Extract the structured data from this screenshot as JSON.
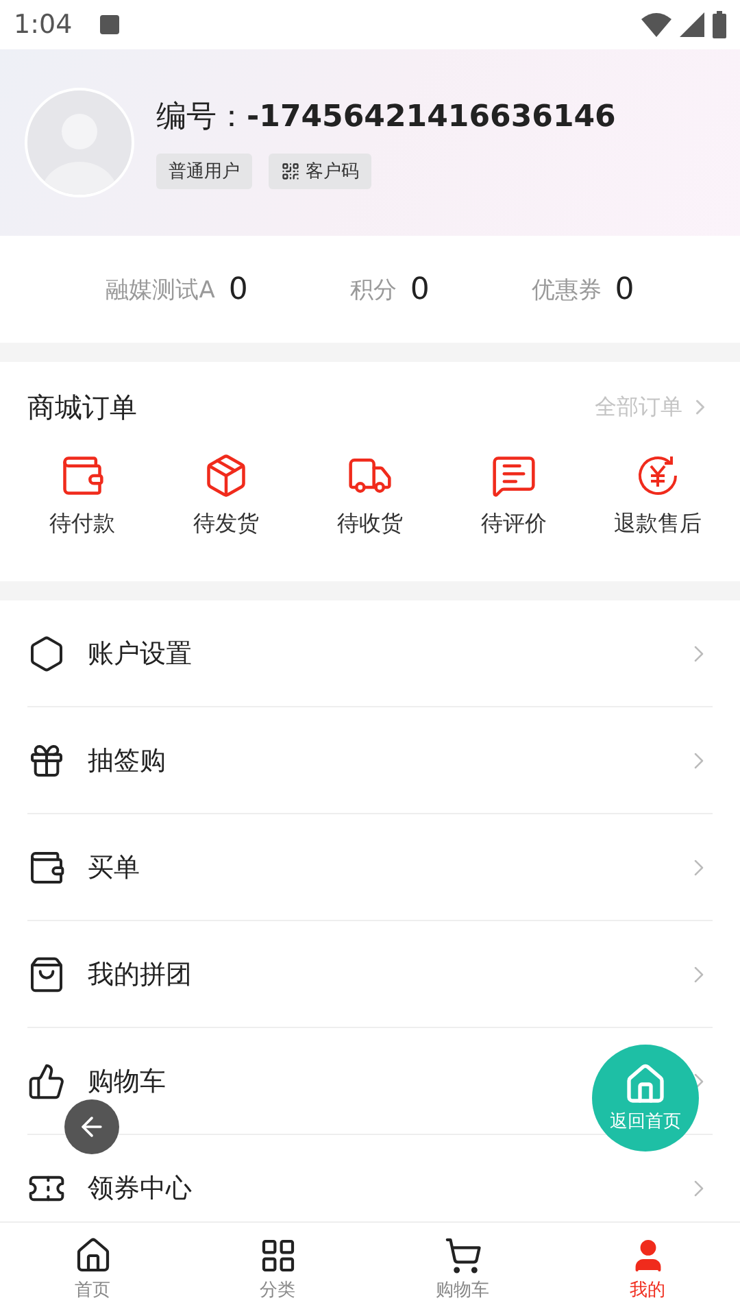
{
  "status_bar": {
    "time": "1:04"
  },
  "profile": {
    "id_label": "编号：",
    "id_value": "-17456421416636146",
    "tags": [
      {
        "label": "普通用户",
        "kind": "plain"
      },
      {
        "label": "客户码",
        "kind": "qr"
      }
    ]
  },
  "stats": [
    {
      "label": "融媒测试A",
      "value": "0"
    },
    {
      "label": "积分",
      "value": "0"
    },
    {
      "label": "优惠券",
      "value": "0"
    }
  ],
  "orders": {
    "title": "商城订单",
    "all_link": "全部订单",
    "items": [
      {
        "label": "待付款",
        "kind": "wallet"
      },
      {
        "label": "待发货",
        "kind": "box"
      },
      {
        "label": "待收货",
        "kind": "truck"
      },
      {
        "label": "待评价",
        "kind": "comment"
      },
      {
        "label": "退款售后",
        "kind": "refund"
      }
    ]
  },
  "menu": [
    {
      "label": "账户设置",
      "kind": "settings"
    },
    {
      "label": "抽签购",
      "kind": "lottery"
    },
    {
      "label": "买单",
      "kind": "wallet"
    },
    {
      "label": "我的拼团",
      "kind": "bag"
    },
    {
      "label": "购物车",
      "kind": "like"
    },
    {
      "label": "领券中心",
      "kind": "coupon"
    }
  ],
  "floating": {
    "home_label": "返回首页"
  },
  "bottom_nav": [
    {
      "label": "首页",
      "kind": "home",
      "selected": false
    },
    {
      "label": "分类",
      "kind": "grid",
      "selected": false
    },
    {
      "label": "购物车",
      "kind": "cart",
      "selected": false
    },
    {
      "label": "我的",
      "kind": "user",
      "selected": true
    }
  ]
}
